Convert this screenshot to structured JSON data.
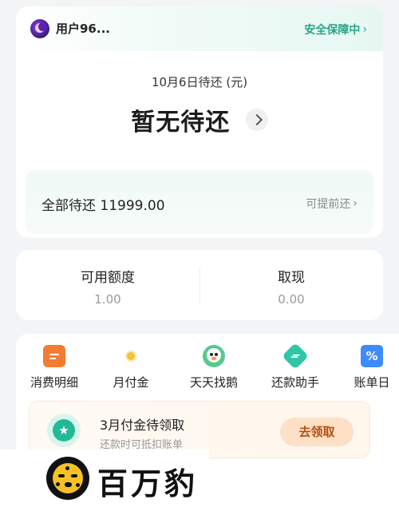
{
  "header": {
    "username": "用户96...",
    "safety_label": "安全保障中",
    "safety_chevron": "›"
  },
  "due": {
    "date_label": "10月6日待还 (元)",
    "status": "暂无待还",
    "total_label": "全部待还 11999.00",
    "prepay_label": "可提前还",
    "prepay_chevron": "›"
  },
  "credit": {
    "available_label": "可用额度",
    "available_value": "1.00",
    "withdraw_label": "取现",
    "withdraw_value": "0.00"
  },
  "tools": [
    {
      "label": "消费明细",
      "icon": "bill-icon"
    },
    {
      "label": "月付金",
      "icon": "coin-icon"
    },
    {
      "label": "天天找鹅",
      "icon": "penguin-icon"
    },
    {
      "label": "还款助手",
      "icon": "exchange-icon"
    },
    {
      "label": "账单日",
      "icon": "calendar-percent-icon"
    }
  ],
  "promo": {
    "title": "3月付金待领取",
    "subtitle": "还款时可抵扣账单",
    "button": "去领取",
    "icon_glyph": "★"
  },
  "watermark": {
    "brand": "百万豹"
  },
  "colors": {
    "accent_green": "#2aa585",
    "promo_button_bg": "#fde0c5",
    "promo_button_text": "#b44f12",
    "page_bg": "#f3f4f6"
  }
}
